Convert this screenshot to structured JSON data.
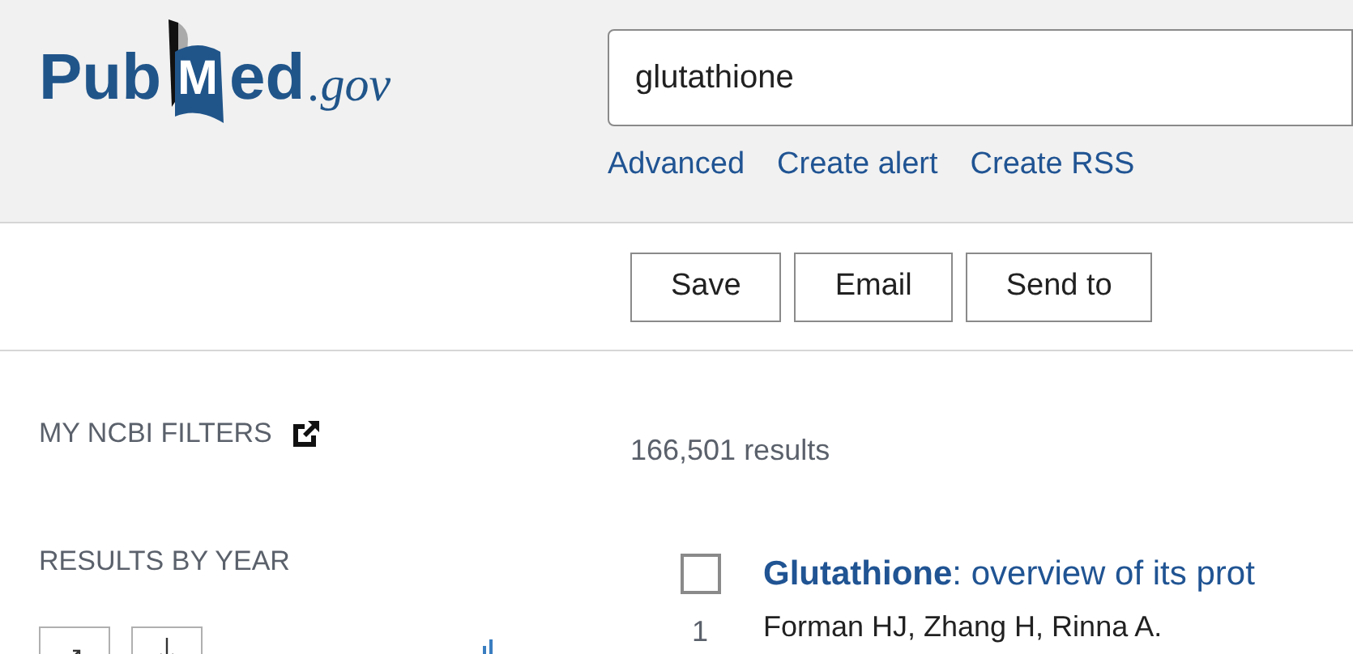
{
  "logo": {
    "before": "Pub",
    "boxed": "M",
    "after": "ed",
    "suffix": ".gov"
  },
  "search": {
    "value": "glutathione"
  },
  "search_links": [
    "Advanced",
    "Create alert",
    "Create RSS"
  ],
  "actions": [
    "Save",
    "Email",
    "Send to"
  ],
  "sidebar": {
    "filters_title": "MY NCBI FILTERS",
    "year_title": "RESULTS BY YEAR"
  },
  "results_count": "166,501 results",
  "results": [
    {
      "number": "1",
      "checked": false,
      "title": "**Glutathione**: overview of its prot",
      "authors": "Forman HJ, Zhang H, Rinna A."
    }
  ]
}
